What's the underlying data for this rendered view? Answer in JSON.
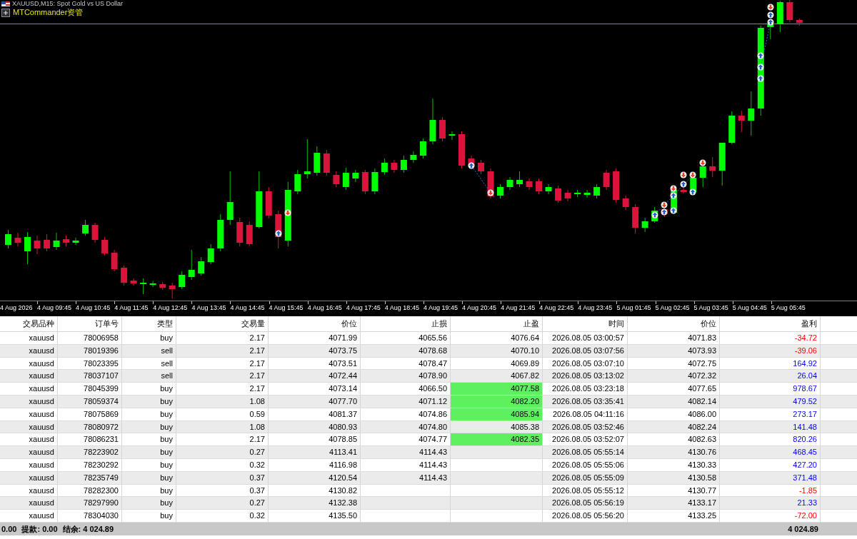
{
  "chart": {
    "title": "XAUUSD,M15: Spot Gold vs US Dollar",
    "indicator_label": "MTCommander资管",
    "time_axis": [
      "4 Aug 2026",
      "4 Aug 09:45",
      "4 Aug 10:45",
      "4 Aug 11:45",
      "4 Aug 12:45",
      "4 Aug 13:45",
      "4 Aug 14:45",
      "4 Aug 15:45",
      "4 Aug 16:45",
      "4 Aug 17:45",
      "4 Aug 18:45",
      "4 Aug 19:45",
      "4 Aug 20:45",
      "4 Aug 21:45",
      "4 Aug 22:45",
      "4 Aug 23:45",
      "5 Aug 01:45",
      "5 Aug 02:45",
      "5 Aug 03:45",
      "5 Aug 04:45",
      "5 Aug 05:45"
    ]
  },
  "table": {
    "columns": [
      "交易品种",
      "订单号",
      "类型",
      "交易量",
      "价位",
      "止损",
      "止盈",
      "时间",
      "价位",
      "盈利"
    ],
    "rows": [
      {
        "symbol": "xauusd",
        "order": "78006958",
        "type": "buy",
        "volume": "2.17",
        "price": "4071.99",
        "stop_loss": "4065.56",
        "take_profit": "4076.64",
        "take_profit_highlighted": false,
        "time": "2026.08.05 03:00:57",
        "current_price": "4071.83",
        "profit": "-34.72",
        "loss": true
      },
      {
        "symbol": "xauusd",
        "order": "78019396",
        "type": "sell",
        "volume": "2.17",
        "price": "4073.75",
        "stop_loss": "4078.68",
        "take_profit": "4070.10",
        "take_profit_highlighted": false,
        "time": "2026.08.05 03:07:56",
        "current_price": "4073.93",
        "profit": "-39.06",
        "loss": true
      },
      {
        "symbol": "xauusd",
        "order": "78023395",
        "type": "sell",
        "volume": "2.17",
        "price": "4073.51",
        "stop_loss": "4078.47",
        "take_profit": "4069.89",
        "take_profit_highlighted": false,
        "time": "2026.08.05 03:07:10",
        "current_price": "4072.75",
        "profit": "164.92",
        "loss": false
      },
      {
        "symbol": "xauusd",
        "order": "78037107",
        "type": "sell",
        "volume": "2.17",
        "price": "4072.44",
        "stop_loss": "4078.90",
        "take_profit": "4067.82",
        "take_profit_highlighted": false,
        "time": "2026.08.05 03:13:02",
        "current_price": "4072.32",
        "profit": "26.04",
        "loss": false
      },
      {
        "symbol": "xauusd",
        "order": "78045399",
        "type": "buy",
        "volume": "2.17",
        "price": "4073.14",
        "stop_loss": "4066.50",
        "take_profit": "4077.58",
        "take_profit_highlighted": true,
        "time": "2026.08.05 03:23:18",
        "current_price": "4077.65",
        "profit": "978.67",
        "loss": false
      },
      {
        "symbol": "xauusd",
        "order": "78059374",
        "type": "buy",
        "volume": "1.08",
        "price": "4077.70",
        "stop_loss": "4071.12",
        "take_profit": "4082.20",
        "take_profit_highlighted": true,
        "time": "2026.08.05 03:35:41",
        "current_price": "4082.14",
        "profit": "479.52",
        "loss": false
      },
      {
        "symbol": "xauusd",
        "order": "78075869",
        "type": "buy",
        "volume": "0.59",
        "price": "4081.37",
        "stop_loss": "4074.86",
        "take_profit": "4085.94",
        "take_profit_highlighted": true,
        "time": "2026.08.05 04:11:16",
        "current_price": "4086.00",
        "profit": "273.17",
        "loss": false
      },
      {
        "symbol": "xauusd",
        "order": "78080972",
        "type": "buy",
        "volume": "1.08",
        "price": "4080.93",
        "stop_loss": "4074.80",
        "take_profit": "4085.38",
        "take_profit_highlighted": false,
        "time": "2026.08.05 03:52:46",
        "current_price": "4082.24",
        "profit": "141.48",
        "loss": false
      },
      {
        "symbol": "xauusd",
        "order": "78086231",
        "type": "buy",
        "volume": "2.17",
        "price": "4078.85",
        "stop_loss": "4074.77",
        "take_profit": "4082.35",
        "take_profit_highlighted": true,
        "time": "2026.08.05 03:52:07",
        "current_price": "4082.63",
        "profit": "820.26",
        "loss": false
      },
      {
        "symbol": "xauusd",
        "order": "78223902",
        "type": "buy",
        "volume": "0.27",
        "price": "4113.41",
        "stop_loss": "4114.43",
        "time": "2026.08.05 05:55:14",
        "current_price": "4130.76",
        "profit": "468.45",
        "loss": false
      },
      {
        "symbol": "xauusd",
        "order": "78230292",
        "type": "buy",
        "volume": "0.32",
        "price": "4116.98",
        "stop_loss": "4114.43",
        "time": "2026.08.05 05:55:06",
        "current_price": "4130.33",
        "profit": "427.20",
        "loss": false
      },
      {
        "symbol": "xauusd",
        "order": "78235749",
        "type": "buy",
        "volume": "0.37",
        "price": "4120.54",
        "stop_loss": "4114.43",
        "time": "2026.08.05 05:55:09",
        "current_price": "4130.58",
        "profit": "371.48",
        "loss": false
      },
      {
        "symbol": "xauusd",
        "order": "78282300",
        "type": "buy",
        "volume": "0.37",
        "price": "4130.82",
        "time": "2026.08.05 05:55:12",
        "current_price": "4130.77",
        "profit": "-1.85",
        "loss": true
      },
      {
        "symbol": "xauusd",
        "order": "78297990",
        "type": "buy",
        "volume": "0.27",
        "price": "4132.38",
        "time": "2026.08.05 05:56:19",
        "current_price": "4133.17",
        "profit": "21.33",
        "loss": false
      },
      {
        "symbol": "xauusd",
        "order": "78304030",
        "type": "buy",
        "volume": "0.32",
        "price": "4135.50",
        "time": "2026.08.05 05:56:20",
        "current_price": "4133.25",
        "profit": "-72.00",
        "loss": true
      }
    ]
  },
  "status_bar": {
    "items": [
      "0.00",
      "提款: 0.00",
      "结余: 4 024.89"
    ],
    "total": "4 024.89"
  }
}
